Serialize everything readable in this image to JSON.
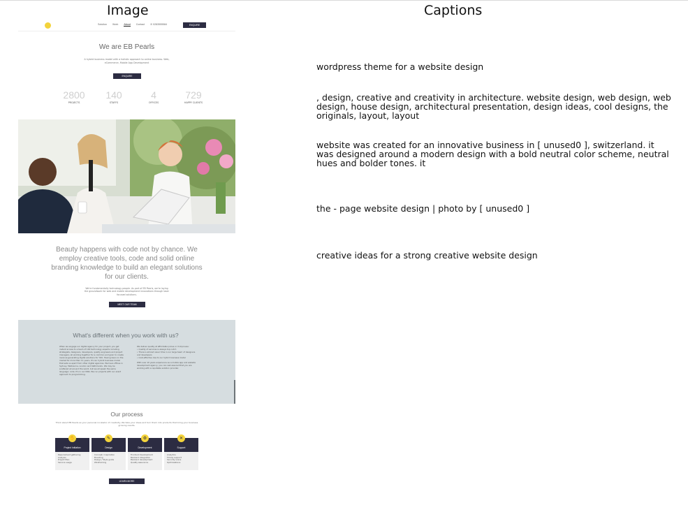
{
  "headers": {
    "image": "Image",
    "captions": "Captions"
  },
  "website": {
    "nav": {
      "links": [
        "Solution",
        "Work",
        "About",
        "Contact"
      ],
      "phone": "0283555584",
      "cta": "ENQUIRE"
    },
    "hero": {
      "title": "We are EB Pearls",
      "subtitle": "A hybrid business model with a holistic approach to online business. Web, eCommerce, Mobile App Development",
      "button": "ENQUIRE"
    },
    "stats": [
      {
        "value": "2800",
        "label": "PROJECTS"
      },
      {
        "value": "140",
        "label": "STAFFS"
      },
      {
        "value": "4",
        "label": "OFFICES"
      },
      {
        "value": "729",
        "label": "HAPPY CLIENTS"
      }
    ],
    "beauty": {
      "headline": "Beauty happens with code not by chance. We employ creative tools, code and solid online branding knowledge to build an elegant solutions for our clients.",
      "text": "We're fundamentally technology people. As part of EB Pearls, we're laying the groundwork for web and mobile development innovations through laser focused solutions.",
      "button": "MEET OUR TEAM"
    },
    "difference": {
      "title": "What's different when you work with us?",
      "left_text": "When we engage our digital agency for your project, you get instant access to a team of 140 technology experts including strategists, designers, developers, quality engineers and project managers, all working together for a common end goal: to create revenue-generating digital solutions for YOU. Having been on the market for more than 11 years, it's our hybrid business model that sets us apart from other digital agencies. We have offices in Sydney, Melbourne, London and Kathmandu. We may be scattered all around the world, but we all speak the same language: code. It's in our DNA. We run projects with our exact approach to programming.",
      "right_intro": "We deliver quality at affordable prices or it improves:",
      "right_bullets": [
        "Quality of services is always top notch",
        "There is almost never time in our large team of designers and developers",
        "Cost-effective due to our hybrid business model"
      ],
      "right_outro": "With over 10 years experience as a mobile app and website development agency, you can rest assured that you are working with a reputable solution provider."
    },
    "process": {
      "title": "Our process",
      "subtitle": "Think about EB Pearls as your personal incubator of creativity. We take your ideas and turn them into products that bring your business growing results.",
      "cards": [
        {
          "name": "Project Initiation",
          "items": [
            "Requirement gathering",
            "Analysis",
            "Project Plan",
            "Service usage"
          ]
        },
        {
          "name": "Design",
          "items": [
            "Concept / inspiration",
            "Branding",
            "Design / Style guide",
            "Wireframing"
          ]
        },
        {
          "name": "Development",
          "items": [
            "Frontend development",
            "Backend integration",
            "Backend development",
            "Quality assurance"
          ]
        },
        {
          "name": "Support",
          "items": [
            "Analytics",
            "Timely support",
            "Security scans",
            "Optimisations"
          ]
        }
      ],
      "button": "LEARN MORE"
    }
  },
  "captions": [
    "wordpress theme for a website design",
    ", design, creative and creativity in architecture. website design, web design, web design, house design, architectural presentation, design ideas, cool designs, the originals, layout, layout",
    "website was created for an innovative business in [ unused0 ], switzerland. it was designed around a modern design with a bold neutral color scheme, neutral hues and bolder tones. it",
    "the - page website design | photo by [ unused0 ]",
    "creative ideas for a strong creative website design"
  ],
  "colors": {
    "brand_dark": "#2c2c42",
    "brand_yellow": "#f3d33b",
    "section_grey": "#d6dde0"
  }
}
